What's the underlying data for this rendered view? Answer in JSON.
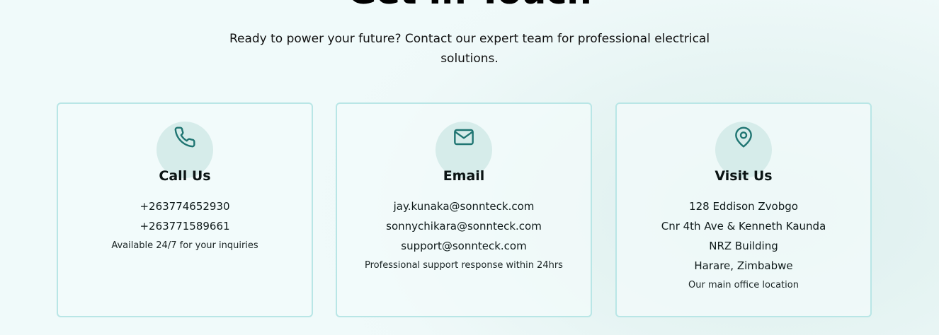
{
  "header": {
    "title": "Get In Touch",
    "subtitle": "Ready to power your future? Contact our expert team for professional electrical solutions."
  },
  "cards": [
    {
      "icon": "phone-icon",
      "title": "Call Us",
      "lines": [
        "+263774652930",
        "+263771589661"
      ],
      "note": "Available 24/7 for your inquiries"
    },
    {
      "icon": "mail-icon",
      "title": "Email",
      "lines": [
        "jay.kunaka@sonnteck.com",
        "sonnychikara@sonnteck.com",
        "support@sonnteck.com"
      ],
      "note": "Professional support response within 24hrs"
    },
    {
      "icon": "map-pin-icon",
      "title": "Visit Us",
      "lines": [
        "128 Eddison Zvobgo",
        "Cnr 4th Ave & Kenneth Kaunda",
        "NRZ Building",
        "Harare, Zimbabwe"
      ],
      "note": "Our main office location"
    }
  ],
  "colors": {
    "accent": "#1f7572",
    "icon_bg": "#d6ecea",
    "card_border": "#b9e6e6"
  }
}
